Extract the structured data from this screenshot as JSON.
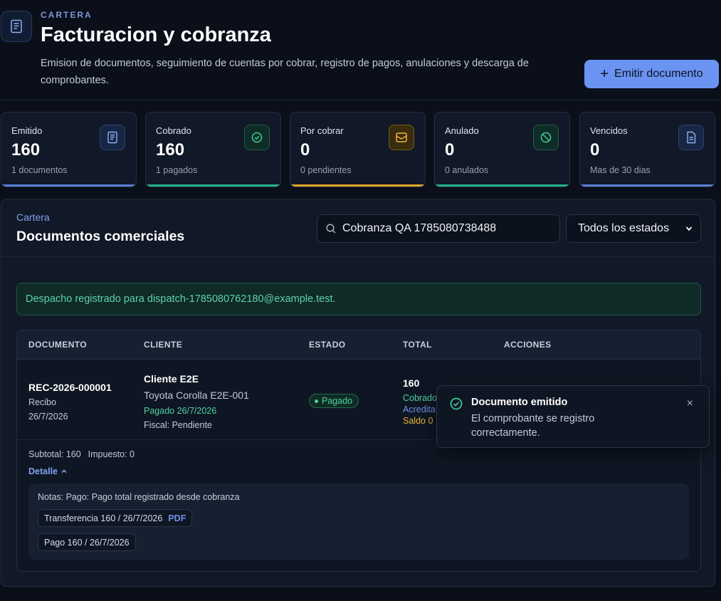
{
  "header": {
    "eyebrow": "CARTERA",
    "title": "Facturacion y cobranza",
    "subtitle": "Emision de documentos, seguimiento de cuentas por cobrar, registro de pagos, anulaciones y descarga de comprobantes.",
    "emit_button": "Emitir documento",
    "icon": "document-icon"
  },
  "stats": [
    {
      "label": "Emitido",
      "value": "160",
      "sub": "1 documentos",
      "icon": "receipt-icon",
      "accent": "#5b7fd6"
    },
    {
      "label": "Cobrado",
      "value": "160",
      "sub": "1 pagados",
      "icon": "check-circle-icon",
      "accent": "#22b487"
    },
    {
      "label": "Por cobrar",
      "value": "0",
      "sub": "0 pendientes",
      "icon": "inbox-icon",
      "accent": "#e0a92a"
    },
    {
      "label": "Anulado",
      "value": "0",
      "sub": "0 anulados",
      "icon": "ban-icon",
      "accent": "#22b487"
    },
    {
      "label": "Vencidos",
      "value": "0",
      "sub": "Mas de 30 dias",
      "icon": "file-icon",
      "accent": "#5b7fd6"
    }
  ],
  "panel": {
    "eyebrow": "Cartera",
    "title": "Documentos comerciales",
    "search_value": "Cobranza QA 1785080738488",
    "filter_selected": "Todos los estados",
    "alert": "Despacho registrado para dispatch-1785080762180@example.test."
  },
  "table": {
    "headers": [
      "DOCUMENTO",
      "CLIENTE",
      "ESTADO",
      "TOTAL",
      "ACCIONES"
    ],
    "row": {
      "doc_id": "REC-2026-000001",
      "doc_type": "Recibo",
      "doc_date": "26/7/2026",
      "client_name": "Cliente E2E",
      "client_vehicle": "Toyota Corolla E2E-001",
      "client_paid": "Pagado 26/7/2026",
      "client_fiscal": "Fiscal: Pendiente",
      "status": "Pagado",
      "total": "160",
      "total_cobrado": "Cobrado",
      "total_acreditado": "Acredita",
      "total_saldo": "Saldo 0",
      "subtotal": "Subtotal: 160",
      "impuesto": "Impuesto: 0",
      "detail_label": "Detalle",
      "notes": "Notas: Pago: Pago total registrado desde cobranza",
      "chip_transfer": "Transferencia 160 / 26/7/2026",
      "chip_pdf": "PDF",
      "chip_payment": "Pago 160 / 26/7/2026"
    }
  },
  "toast": {
    "title": "Documento emitido",
    "body": "El comprobante se registro correctamente.",
    "close": "×"
  },
  "colors": {
    "accent_blue": "#6b93f2",
    "success_green": "#4fd1a0",
    "warning_yellow": "#e8b33a"
  }
}
